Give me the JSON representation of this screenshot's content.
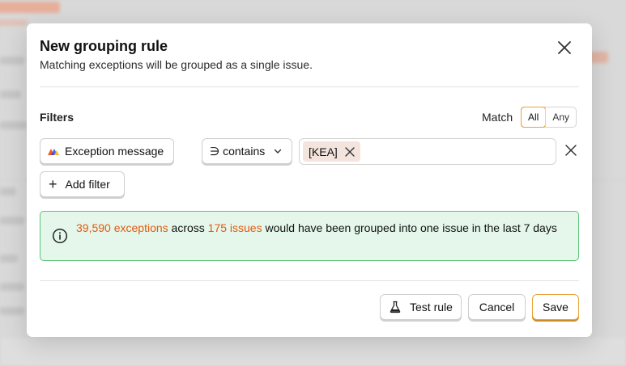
{
  "modal": {
    "title": "New grouping rule",
    "subtitle": "Matching exceptions will be grouped as a single issue.",
    "close_icon": "close-icon"
  },
  "filters": {
    "label": "Filters",
    "match_label": "Match",
    "match_options": [
      "All",
      "Any"
    ],
    "match_selected": "All",
    "rows": [
      {
        "property": "Exception message",
        "property_icon": "exception-type-icon",
        "operator": "∋ contains",
        "values": [
          "[KEA]"
        ]
      }
    ],
    "add_filter_label": "Add filter"
  },
  "summary": {
    "icon": "info-icon",
    "exceptions_count": "39,590 exceptions",
    "across": " across ",
    "issues_count": "175 issues",
    "rest": " would have been grouped into one issue in the last 7 days",
    "highlight_color": "#e3590e",
    "background_color": "#e5f7ea",
    "border_color": "#5cc27a"
  },
  "footer": {
    "test_label": "Test rule",
    "cancel_label": "Cancel",
    "save_label": "Save",
    "accent_color": "#e8a43a"
  }
}
